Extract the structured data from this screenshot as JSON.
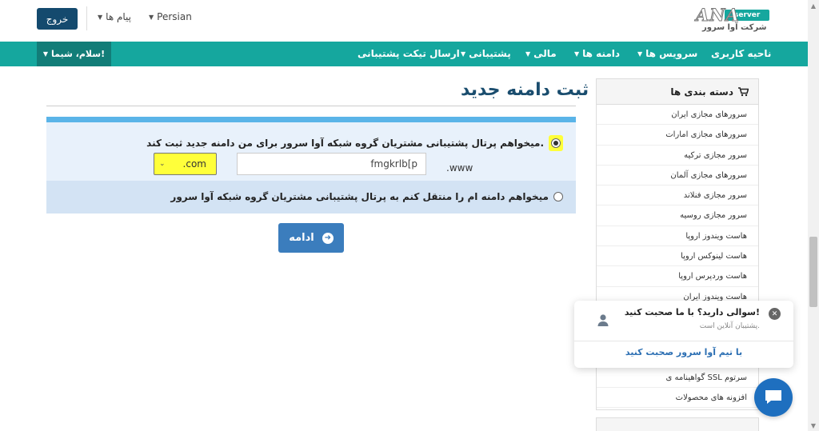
{
  "header": {
    "logout_label": "خروج",
    "messages_label": "پیام ها",
    "language_label": "Persian",
    "logo_text": "ANA",
    "logo_badge": "server",
    "company_name": "شرکت آوا سرور"
  },
  "nav": {
    "greeting": "سلام، شیما!",
    "items": [
      {
        "label": "ناحیه کاربری"
      },
      {
        "label": "سرویس ها"
      },
      {
        "label": "دامنه ها"
      },
      {
        "label": "مالی"
      },
      {
        "label": "پشتیبانی"
      },
      {
        "label": "ارسال تیکت پشتیبانی"
      }
    ]
  },
  "main": {
    "title": "ثبت دامنه جدید",
    "option_register": "میخواهم پرتال پشتیبانی مشتریان گروه شبکه آوا سرور برای من دامنه جدید ثبت کند.",
    "www_prefix": ".www",
    "domain_value": "fmgkrlb[p",
    "tld_selected": ".com",
    "option_transfer": "میخواهم دامنه ام را منتقل کنم به پرتال پشتیبانی مشتریان گروه شبکه آوا سرور",
    "continue_label": "ادامه"
  },
  "sidebar": {
    "heading": "دسته بندی ها",
    "items": [
      {
        "label": "سرورهای مجازی ایران"
      },
      {
        "label": "سرورهای مجازی امارات"
      },
      {
        "label": "سرور مجازی ترکیه"
      },
      {
        "label": "سرورهای مجازی آلمان"
      },
      {
        "label": "سرور مجازی فنلاند"
      },
      {
        "label": "سرور مجازی روسیه"
      },
      {
        "label": "هاست ویندوز اروپا"
      },
      {
        "label": "هاست لینوکس اروپا"
      },
      {
        "label": "هاست وردپرس اروپا"
      },
      {
        "label": "هاست ویندوز ایران"
      },
      {
        "label": ""
      },
      {
        "label": ""
      },
      {
        "label": ""
      },
      {
        "label": "گواهینامه ی SSL سرتوم"
      },
      {
        "label": "افزونه های محصولات"
      }
    ]
  },
  "chat": {
    "question": "سوالی دارید؟ با ما صحبت کنید!",
    "status": "پشتیبان آنلاین است.",
    "link": "با تیم آوا سرور صحبت کنید"
  },
  "colors": {
    "teal": "#15a79e",
    "teal_dark": "#127d78",
    "navy": "#144a6e",
    "title_blue": "#1a4d6e",
    "button_blue": "#3b7dbd",
    "highlight": "#ffff3a"
  }
}
